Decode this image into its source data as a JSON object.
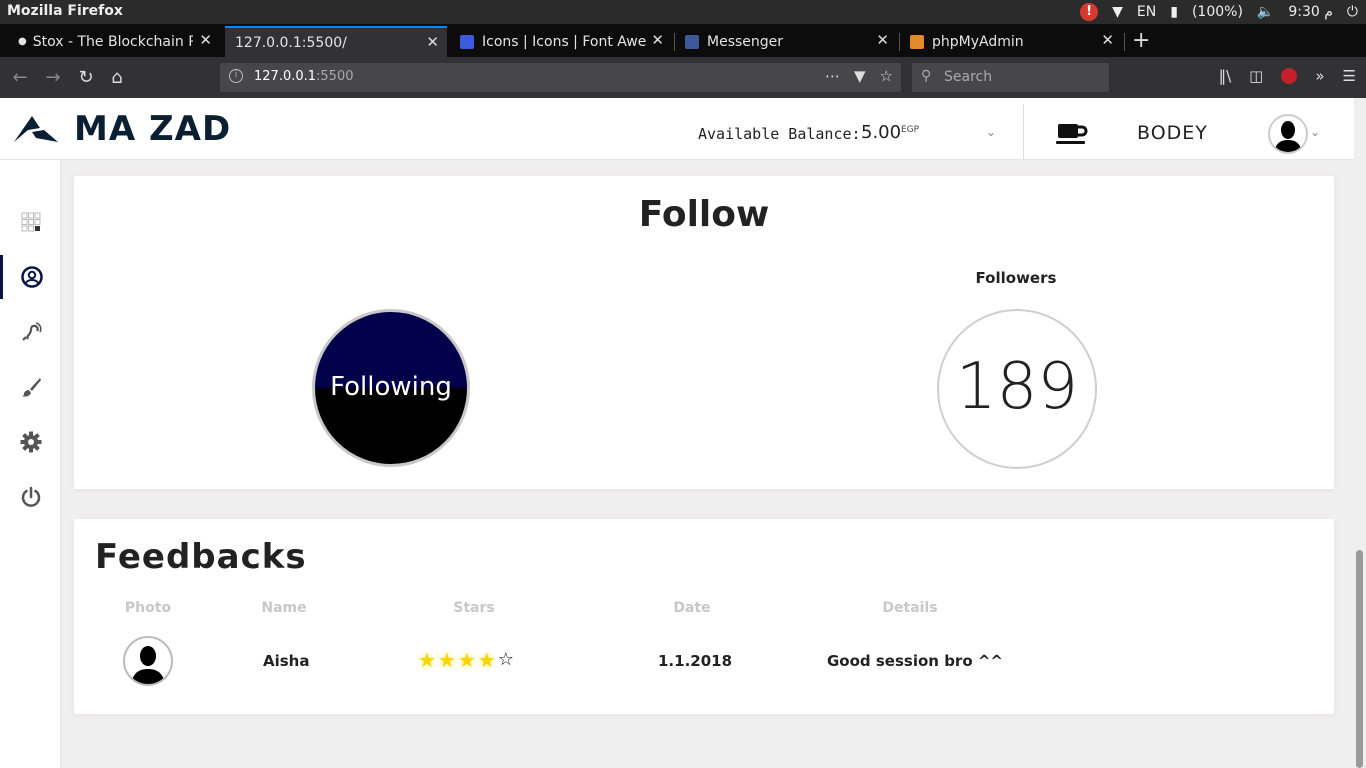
{
  "os": {
    "window_title": "Mozilla Firefox",
    "language": "EN",
    "battery": "(100%)",
    "clock": "9:30 م"
  },
  "browser": {
    "tabs": [
      {
        "label": "Stox - The Blockchain Pr",
        "active": false,
        "icon": "bullet-icon"
      },
      {
        "label": "127.0.0.1:5500/",
        "active": true,
        "icon": ""
      },
      {
        "label": "Icons | Icons | Font Awes",
        "active": false,
        "icon": "flag-icon"
      },
      {
        "label": "Messenger",
        "active": false,
        "icon": "facebook-icon"
      },
      {
        "label": "phpMyAdmin",
        "active": false,
        "icon": "sail-icon"
      }
    ],
    "url_host": "127.0.0.1",
    "url_port": ":5500",
    "search_placeholder": "Search"
  },
  "header": {
    "brand": "MA ZAD",
    "balance_label": "Available Balance:",
    "balance_value": "5.00",
    "balance_currency": "EGP",
    "username": "BODEY"
  },
  "sidebar": {
    "items": [
      {
        "name": "dashboard",
        "icon": "grid-icon",
        "active": false
      },
      {
        "name": "profile",
        "icon": "user-circle-icon",
        "active": true
      },
      {
        "name": "listening",
        "icon": "assistive-listening-icon",
        "active": false
      },
      {
        "name": "brush",
        "icon": "paint-brush-icon",
        "active": false
      },
      {
        "name": "settings",
        "icon": "gear-icon",
        "active": false
      },
      {
        "name": "logout",
        "icon": "power-icon",
        "active": false
      }
    ]
  },
  "follow": {
    "title": "Follow",
    "following_label": "Following",
    "followers_label": "Followers",
    "followers_count": "189"
  },
  "feedbacks": {
    "title": "Feedbacks",
    "columns": [
      "Photo",
      "Name",
      "Stars",
      "Date",
      "Details"
    ],
    "rows": [
      {
        "name": "Aisha",
        "stars": 4,
        "max_stars": 5,
        "date": "1.1.2018",
        "details": "Good session bro ^^"
      }
    ]
  },
  "colors": {
    "brand_navy": "#0b1f33",
    "following_top": "#02004a",
    "star": "#f6d500",
    "tab_accent": "#0a84ff"
  }
}
